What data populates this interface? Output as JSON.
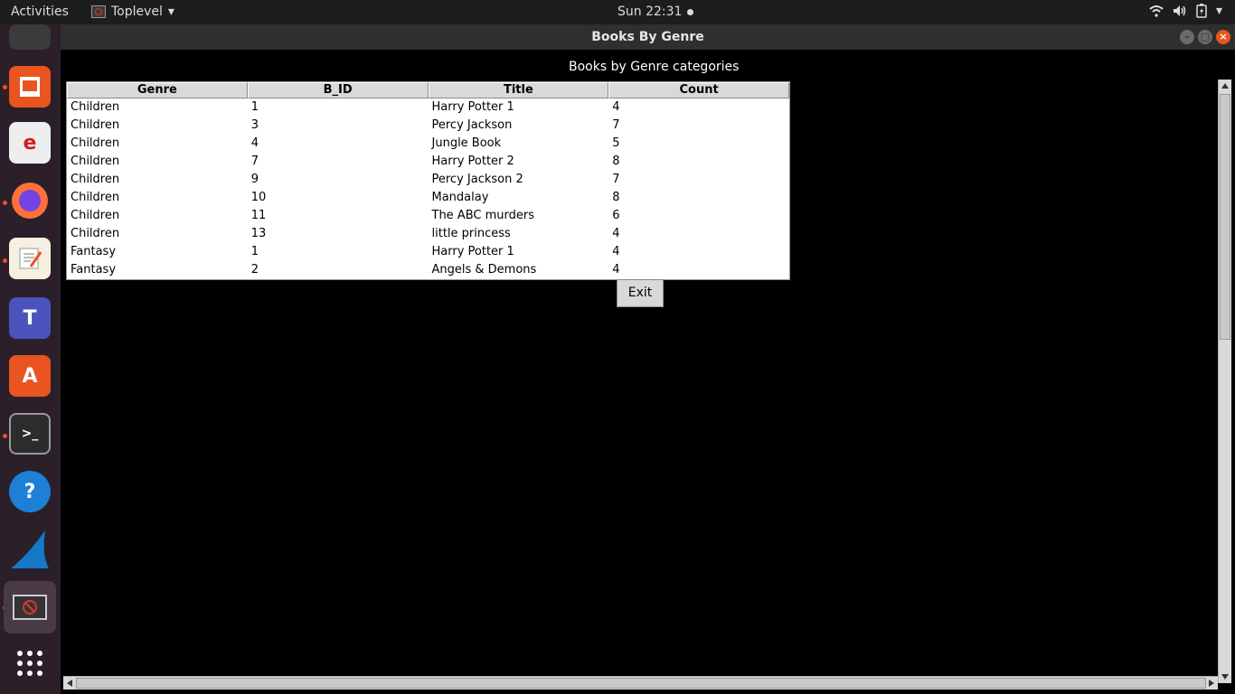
{
  "topbar": {
    "activities": "Activities",
    "app_name": "Toplevel",
    "clock": "Sun 22:31"
  },
  "window": {
    "title": "Books By Genre"
  },
  "main": {
    "heading": "Books by Genre categories",
    "columns": [
      "Genre",
      "B_ID",
      "Title",
      "Count"
    ],
    "rows": [
      [
        "Children",
        "1",
        "Harry Potter 1",
        "4"
      ],
      [
        "Children",
        "3",
        "Percy Jackson",
        "7"
      ],
      [
        "Children",
        "4",
        "Jungle Book",
        "5"
      ],
      [
        "Children",
        "7",
        "Harry Potter 2",
        "8"
      ],
      [
        "Children",
        "9",
        "Percy Jackson 2",
        "7"
      ],
      [
        "Children",
        "10",
        "Mandalay",
        "8"
      ],
      [
        "Children",
        "11",
        "The ABC murders",
        "6"
      ],
      [
        "Children",
        "13",
        "little princess",
        "4"
      ],
      [
        "Fantasy",
        "1",
        "Harry Potter 1",
        "4"
      ],
      [
        "Fantasy",
        "2",
        "Angels & Demons",
        "4"
      ]
    ],
    "exit_label": "Exit"
  },
  "colors": {
    "dock": "#2b1f2a",
    "accent": "#e95420",
    "content_bg": "#000000"
  },
  "icons": [
    "wifi-icon",
    "volume-icon",
    "battery-icon",
    "chevron-down-icon"
  ]
}
